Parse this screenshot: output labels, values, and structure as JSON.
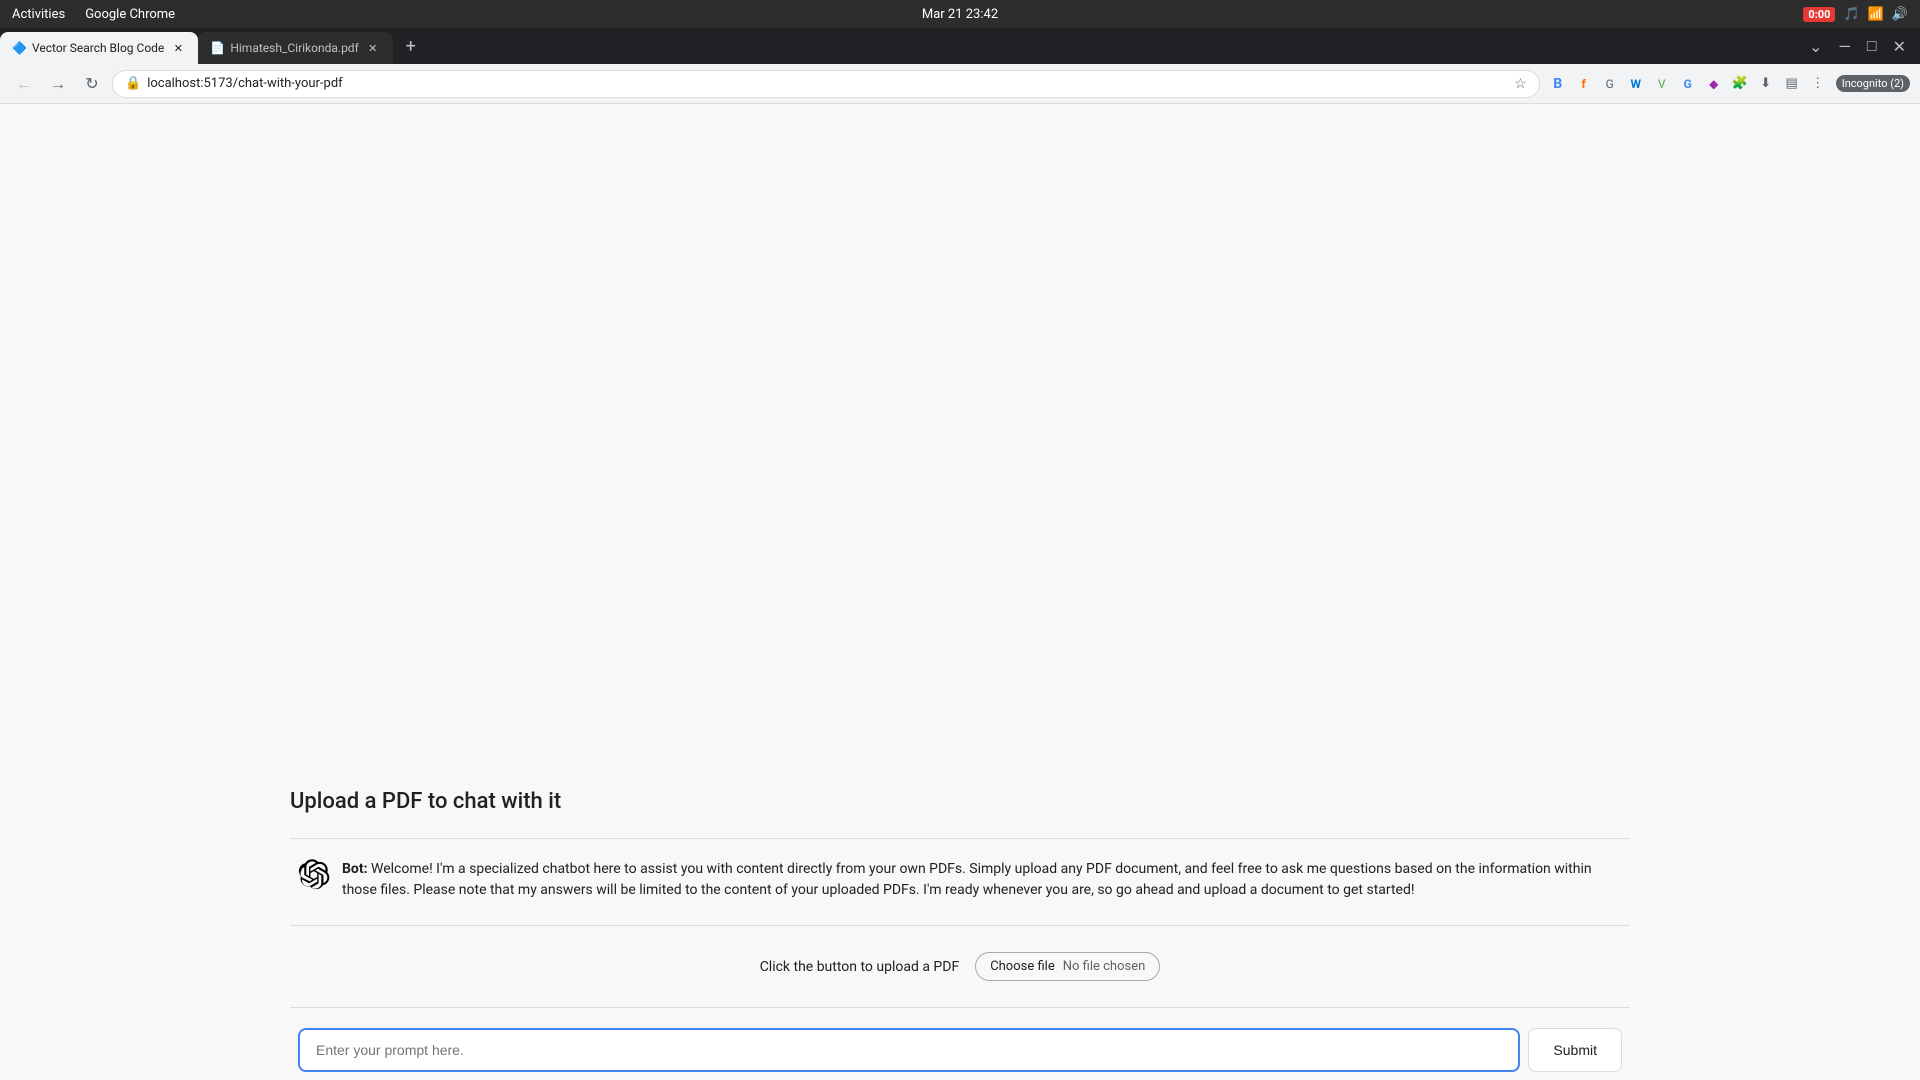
{
  "os_bar": {
    "activities_label": "Activities",
    "app_name": "Google Chrome",
    "datetime": "Mar 21  23:42",
    "recording_label": "0:00"
  },
  "tabs": [
    {
      "id": "tab-1",
      "favicon": "🔷",
      "label": "Vector Search Blog Code",
      "active": true
    },
    {
      "id": "tab-2",
      "favicon": "📄",
      "label": "Himatesh_Cirikonda.pdf",
      "active": false
    }
  ],
  "address_bar": {
    "url": "localhost:5173/chat-with-your-pdf"
  },
  "incognito_badge": "Incognito (2)",
  "page": {
    "title": "Upload a PDF to chat with it",
    "bot_label": "Bot:",
    "bot_message": "Welcome! I'm a specialized chatbot here to assist you with content directly from your own PDFs. Simply upload any PDF document, and feel free to ask me questions based on the information within those files. Please note that my answers will be limited to the content of your uploaded PDFs. I'm ready whenever you are, so go ahead and upload a document to get started!",
    "upload_label": "Click the button to upload a PDF",
    "file_btn_label": "Choose file",
    "file_chosen_text": "No file chosen",
    "prompt_placeholder": "Enter your prompt here.",
    "submit_label": "Submit"
  }
}
